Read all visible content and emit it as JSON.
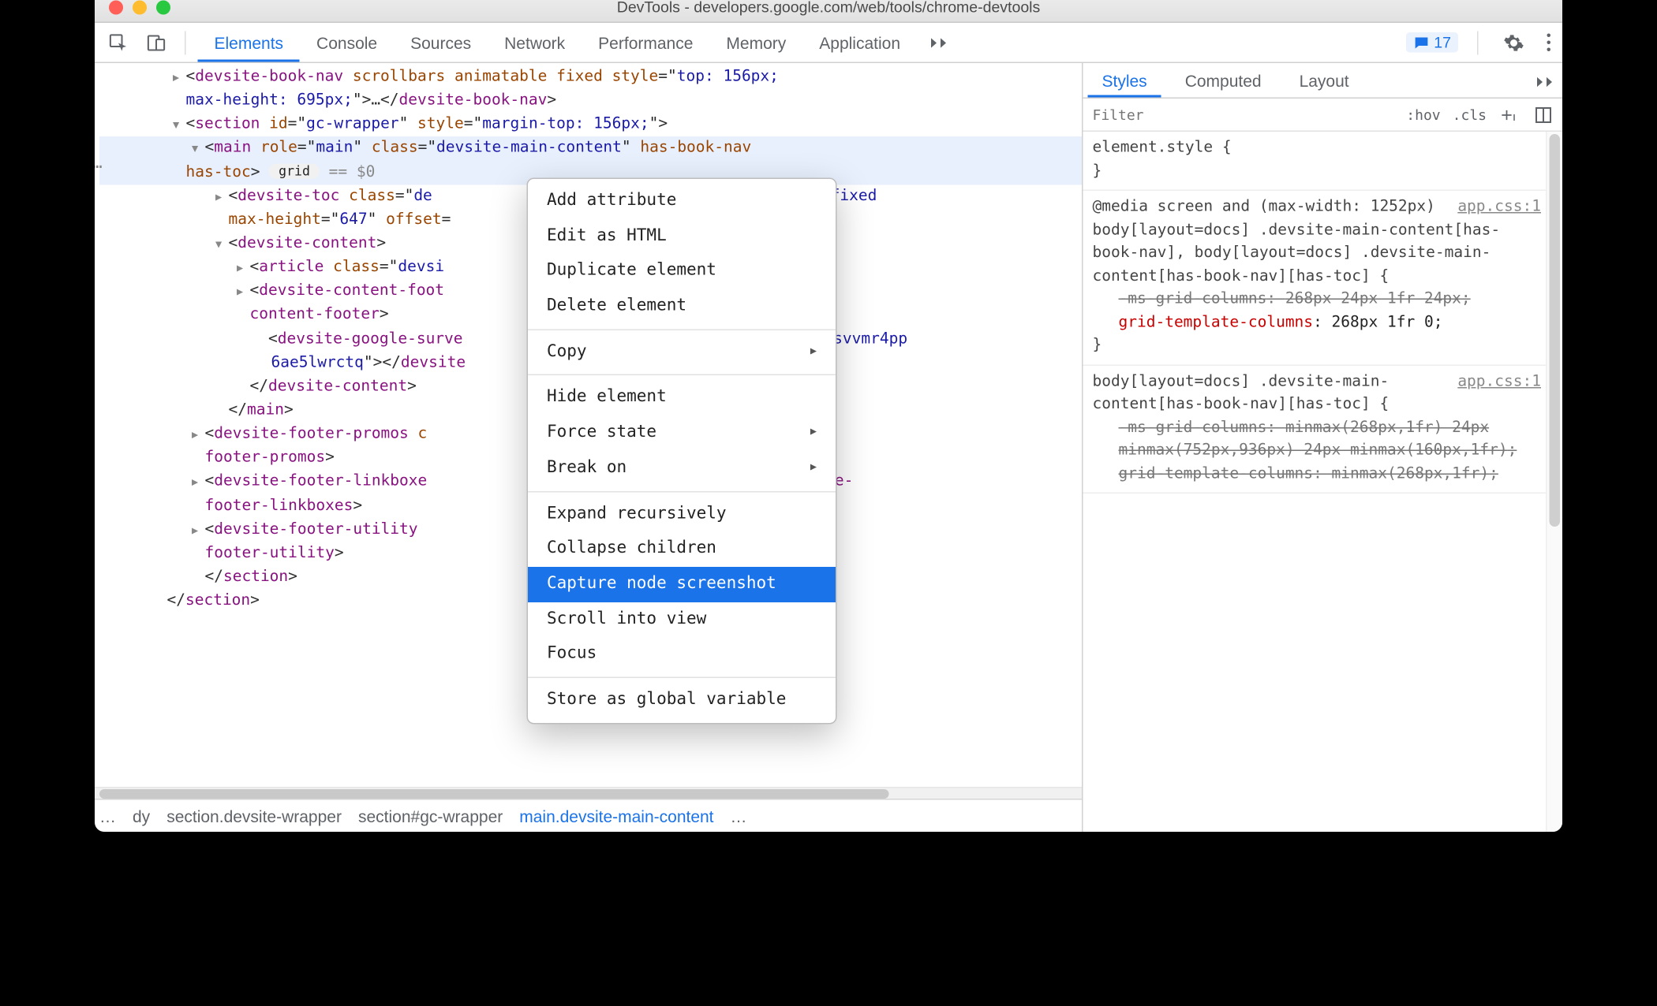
{
  "window_title": "DevTools - developers.google.com/web/tools/chrome-devtools",
  "tabs": [
    "Elements",
    "Console",
    "Sources",
    "Network",
    "Performance",
    "Memory",
    "Application"
  ],
  "active_tab": "Elements",
  "error_count": "17",
  "styles_tabs": [
    "Styles",
    "Computed",
    "Layout"
  ],
  "active_styles_tab": "Styles",
  "filter_placeholder": "Filter",
  "hov_label": ":hov",
  "cls_label": ".cls",
  "dom_lines": [
    {
      "indent": "i1",
      "caret": "closed",
      "html": "<span class='txt'>&lt;</span><span class='tag'>devsite-book-nav</span> <span class='attr'>scrollbars animatable fixed</span> <span class='attr'>style</span><span class='txt'>=</span>\"<span class='val'>top: 156px;</span>"
    },
    {
      "indent": "i1",
      "caret": "none",
      "html": "<span class='val'>max-height: 695px;</span>\"<span class='txt'>&gt;…&lt;/</span><span class='tag'>devsite-book-nav</span><span class='txt'>&gt;</span>"
    },
    {
      "indent": "i1",
      "caret": "open",
      "html": "<span class='txt'>&lt;</span><span class='tag'>section</span> <span class='attr'>id</span><span class='txt'>=</span>\"<span class='val'>gc-wrapper</span>\" <span class='attr'>style</span><span class='txt'>=</span>\"<span class='val'>margin-top: 156px;</span>\"<span class='txt'>&gt;</span>"
    },
    {
      "indent": "i2",
      "caret": "open",
      "sel": true,
      "html": "<span class='txt'>&lt;</span><span class='tag'>main</span> <span class='attr'>role</span><span class='txt'>=</span>\"<span class='val'>main</span>\" <span class='attr'>class</span><span class='txt'>=</span>\"<span class='val'>devsite-main-content</span>\" <span class='attr'>has-book-nav</span>"
    },
    {
      "indent": "i1",
      "caret": "none",
      "sel": true,
      "html": "<span class='attr'>has-toc</span><span class='txt'>&gt; </span><span class='pill'>grid</span> <span style='color:#888'>== $0</span>"
    },
    {
      "indent": "i3",
      "caret": "closed",
      "html": "<span class='txt'>&lt;</span><span class='tag'>devsite-toc</span> <span class='attr'>class</span><span class='txt'>=</span>\"<span class='val'>de&nbsp;&nbsp;&nbsp;&nbsp;&nbsp;&nbsp;&nbsp;&nbsp;&nbsp;&nbsp;&nbsp;&nbsp;&nbsp;&nbsp;&nbsp;&nbsp;&nbsp;&nbsp;&nbsp;&nbsp;&nbsp;&nbsp;&nbsp;&nbsp;&nbsp;&nbsp;&nbsp;&nbsp;&nbsp;&nbsp;&nbsp;&nbsp;&nbsp;&nbsp;&nbsp;&nbsp;&nbsp;sible fixed</span>"
    },
    {
      "indent": "i3",
      "caret": "none",
      "html": "<span class='attr'>max-height</span><span class='txt'>=</span>\"<span class='val'>647</span>\" <span class='attr'>offset</span><span class='txt'>=</span>"
    },
    {
      "indent": "i3",
      "caret": "open",
      "html": "<span class='txt'>&lt;</span><span class='tag'>devsite-content</span><span class='txt'>&gt;</span>"
    },
    {
      "indent": "i4",
      "caret": "closed",
      "html": "<span class='txt'>&lt;</span><span class='tag'>article</span> <span class='attr'>class</span><span class='txt'>=</span>\"<span class='val'>devsi</span>"
    },
    {
      "indent": "i4",
      "caret": "closed",
      "html": "<span class='txt'>&lt;</span><span class='tag'>devsite-content-foot</span>&nbsp;&nbsp;&nbsp;&nbsp;&nbsp;&nbsp;&nbsp;&nbsp;&nbsp;&nbsp;&nbsp;&nbsp;&nbsp;&nbsp;&nbsp;&nbsp;&nbsp;&nbsp;&nbsp;&nbsp;&nbsp;&nbsp;&nbsp;&nbsp;&nbsp;&nbsp;&nbsp;&nbsp;&nbsp;&nbsp;&nbsp;&nbsp;&nbsp;&nbsp;<span class='tag'>devsite-</span>"
    },
    {
      "indent": "i4",
      "caret": "none",
      "html": "<span class='tag'>content-footer</span><span class='txt'>&gt;</span>"
    },
    {
      "indent": "i4",
      "caret": "none",
      "html": "&nbsp;&nbsp;<span class='txt'>&lt;</span><span class='tag'>devsite-google-surve</span>&nbsp;&nbsp;&nbsp;&nbsp;&nbsp;&nbsp;&nbsp;&nbsp;&nbsp;&nbsp;&nbsp;&nbsp;&nbsp;&nbsp;&nbsp;&nbsp;&nbsp;&nbsp;&nbsp;&nbsp;&nbsp;&nbsp;&nbsp;&nbsp;&nbsp;&nbsp;&nbsp;&nbsp;&nbsp;&nbsp;&nbsp;&nbsp;&nbsp;&nbsp;<span class='val'>j5ifxusvvmr4pp</span>"
    },
    {
      "indent": "i5",
      "caret": "none",
      "html": "<span class='val'>6ae5lwrctq</span>\"<span class='txt'>&gt;&lt;/</span><span class='tag'>devsite</span>"
    },
    {
      "indent": "i4",
      "caret": "none",
      "html": "<span class='txt'>&lt;/</span><span class='tag'>devsite-content</span><span class='txt'>&gt;</span>"
    },
    {
      "indent": "i3",
      "caret": "none",
      "html": "<span class='txt'>&lt;/</span><span class='tag'>main</span><span class='txt'>&gt;</span>"
    },
    {
      "indent": "i2",
      "caret": "closed",
      "html": "<span class='txt'>&lt;</span><span class='tag'>devsite-footer-promos</span> <span class='attr'>c</span>&nbsp;&nbsp;&nbsp;&nbsp;&nbsp;&nbsp;&nbsp;&nbsp;&nbsp;&nbsp;&nbsp;&nbsp;&nbsp;&nbsp;&nbsp;&nbsp;&nbsp;&nbsp;&nbsp;&nbsp;&nbsp;&nbsp;&nbsp;&nbsp;&nbsp;&nbsp;&nbsp;&nbsp;&nbsp;&nbsp;&nbsp;&nbsp;&nbsp;&nbsp;&nbsp;<span class='tag'>devsite-</span>"
    },
    {
      "indent": "i2",
      "caret": "none",
      "html": "<span class='tag'>footer-promos</span><span class='txt'>&gt;</span>"
    },
    {
      "indent": "i2",
      "caret": "closed",
      "html": "<span class='txt'>&lt;</span><span class='tag'>devsite-footer-linkboxe</span>&nbsp;&nbsp;&nbsp;&nbsp;&nbsp;&nbsp;&nbsp;&nbsp;&nbsp;&nbsp;&nbsp;&nbsp;&nbsp;&nbsp;&nbsp;&nbsp;&nbsp;&nbsp;&nbsp;&nbsp;&nbsp;&nbsp;&nbsp;&nbsp;&nbsp;&nbsp;&nbsp;&nbsp;&nbsp;&nbsp;&nbsp;&nbsp;&nbsp;&nbsp;&nbsp;…<span class='txt'>&lt;/</span><span class='tag'>devsite-</span>"
    },
    {
      "indent": "i2",
      "caret": "none",
      "html": "<span class='tag'>footer-linkboxes</span><span class='txt'>&gt;</span>"
    },
    {
      "indent": "i2",
      "caret": "closed",
      "html": "<span class='txt'>&lt;</span><span class='tag'>devsite-footer-utility</span> &nbsp;&nbsp;&nbsp;&nbsp;&nbsp;&nbsp;&nbsp;&nbsp;&nbsp;&nbsp;&nbsp;&nbsp;&nbsp;&nbsp;&nbsp;&nbsp;&nbsp;&nbsp;&nbsp;&nbsp;&nbsp;&nbsp;&nbsp;&nbsp;&nbsp;&nbsp;&nbsp;&nbsp;&nbsp;&nbsp;&nbsp;&nbsp;&nbsp;&nbsp;&nbsp;<span class='txt'>/</span><span class='tag'>devsite-</span>"
    },
    {
      "indent": "i2",
      "caret": "none",
      "html": "<span class='tag'>footer-utility</span><span class='txt'>&gt;</span>"
    },
    {
      "indent": "i2",
      "caret": "none",
      "html": "<span class='txt'>&lt;/</span><span class='tag'>section</span><span class='txt'>&gt;</span>"
    },
    {
      "indent": "i0",
      "caret": "none",
      "html": "<span class='txt'>&lt;/</span><span class='tag'>section</span><span class='txt'>&gt;</span>"
    }
  ],
  "context_menu": {
    "groups": [
      [
        "Add attribute",
        "Edit as HTML",
        "Duplicate element",
        "Delete element"
      ],
      [
        {
          "label": "Copy",
          "sub": true
        }
      ],
      [
        "Hide element",
        {
          "label": "Force state",
          "sub": true
        },
        {
          "label": "Break on",
          "sub": true
        }
      ],
      [
        "Expand recursively",
        "Collapse children",
        {
          "label": "Capture node screenshot",
          "hover": true
        },
        "Scroll into view",
        "Focus"
      ],
      [
        "Store as global variable"
      ]
    ]
  },
  "breadcrumb": {
    "left_overflow": "…",
    "items": [
      "dy",
      "section.devsite-wrapper",
      "section#gc-wrapper",
      "main.devsite-main-content"
    ],
    "active": "main.devsite-main-content",
    "right_overflow": "…"
  },
  "styles_rules": [
    {
      "type": "block",
      "lines": [
        {
          "raw": "element.style {"
        },
        {
          "raw": "}"
        }
      ]
    },
    {
      "type": "block",
      "link": "app.css:1",
      "lines": [
        {
          "raw": "@media screen and (max-width: 1252px)"
        },
        {
          "raw": "body[layout=docs] .devsite-main-content[has-book-nav], body[layout=docs] .devsite-main-content[has-book-nav][has-toc] {"
        },
        {
          "prop": true,
          "strike": true,
          "pn": "-ms-grid-columns",
          "pv": "268px 24px 1fr 24px"
        },
        {
          "prop": true,
          "pn": "grid-template-columns",
          "pv": "268px 1fr 0"
        },
        {
          "raw": "}"
        }
      ]
    },
    {
      "type": "block",
      "link": "app.css:1",
      "lines": [
        {
          "raw": "body[layout=docs] .devsite-main-content[has-book-nav][has-toc] {"
        },
        {
          "prop": true,
          "strike": true,
          "pn": "-ms-grid-columns",
          "pv": "minmax(268px,1fr) 24px minmax(752px,936px) 24px minmax(160px,1fr)"
        },
        {
          "prop": true,
          "strike": true,
          "pn": "grid-template-columns",
          "pv": "minmax(268px,1fr)"
        }
      ]
    }
  ]
}
